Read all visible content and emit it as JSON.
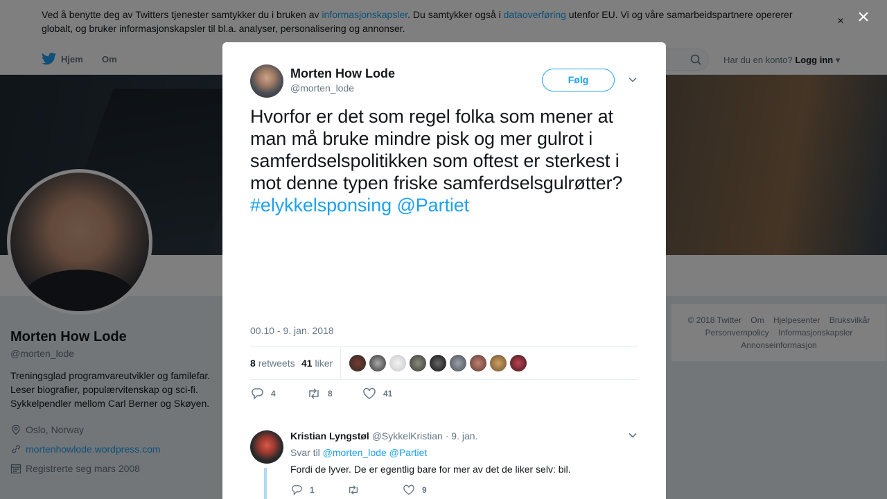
{
  "cookie_banner": {
    "text_1": "Ved å benytte deg av Twitters tjenester samtykker du i bruken av ",
    "link_1": "informasjonskapsler",
    "text_2": ". Du samtykker også i ",
    "link_2": "dataoverføring",
    "text_3": " utenfor EU. Vi og våre samarbeidspartnere opererer globalt, og bruker informasjonskapsler til bl.a. analyser, personalisering og annonser.",
    "close": "×"
  },
  "topnav": {
    "home": "Hjem",
    "about": "Om",
    "account_question": "Har du en konto?",
    "login": "Logg inn"
  },
  "profile": {
    "name": "Morten How Lode",
    "handle": "@morten_lode",
    "bio": "Treningsglad programvareutvikler og familefar. Leser biografier, populærvitenskap og sci-fi. Sykkelpendler mellom Carl Berner og Skøyen.",
    "location": "Oslo, Norway",
    "website": "mortenhowlode.wordpress.com",
    "joined": "Registrerte seg mars 2008"
  },
  "footer": {
    "copyright": "© 2018 Twitter",
    "about": "Om",
    "help": "Hjelpesenter",
    "terms": "Bruksvilkår",
    "privacy": "Personvernpolicy",
    "cookies": "Informasjonskapsler",
    "ads": "Annonseinformasjon"
  },
  "modal": {
    "close": "×",
    "tweet": {
      "author_name": "Morten How Lode",
      "author_handle": "@morten_lode",
      "follow_label": "Følg",
      "text": "Hvorfor er det som regel folka som mener at man må bruke mindre pisk og mer gulrot i samferdselspolitikken som oftest er sterkest i mot denne typen friske samferdselsgulrøtter?",
      "hashtag": "#elykkelsponsing",
      "mention": "@Partiet",
      "timestamp": "00.10 - 9. jan. 2018",
      "retweets_count": "8",
      "retweets_label": "retweets",
      "likes_count": "41",
      "likes_label": "liker",
      "replies_action": "4",
      "retweets_action": "8",
      "likes_action": "41"
    },
    "reply": {
      "author_name": "Kristian Lyngstøl",
      "author_handle": "@SykkelKristian",
      "date": "· 9. jan.",
      "reply_to_label": "Svar til",
      "reply_to_1": "@morten_lode",
      "reply_to_2": "@Partiet",
      "text": "Fordi de lyver. De er egentlig bare for mer av det de liker selv: bil.",
      "replies": "1",
      "likes": "9"
    }
  },
  "colors": {
    "accent": "#1da1f2",
    "muted": "#657786",
    "text": "#14171a"
  }
}
